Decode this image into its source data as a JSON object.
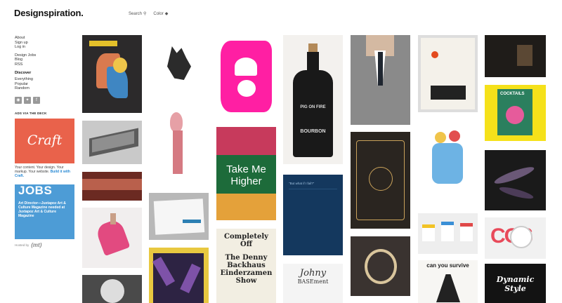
{
  "brand": {
    "logo": "Designspiration."
  },
  "topnav": {
    "search": "Search",
    "color": "Color"
  },
  "sidebar": {
    "group1": [
      "About",
      "Sign up",
      "Log in"
    ],
    "group2": [
      "Design Jobs",
      "Blog",
      "RSS"
    ],
    "discover_heading": "Discover",
    "discover": [
      "Everything",
      "Popular",
      "Random"
    ],
    "social": [
      "instagram-icon",
      "twitter-icon",
      "facebook-icon"
    ]
  },
  "ad": {
    "label": "ADS VIA THE DECK",
    "craft_title": "Craft",
    "craft_text": "Your content. Your design. Your markup. Your website.",
    "craft_link": "Build it with Craft."
  },
  "jobs": {
    "title": "JOBS",
    "text": "Art Director—Juxtapoz Art & Culture Magazine needed at Juxtapoz Art & Culture Magazine"
  },
  "hosted": {
    "label": "Hosted by",
    "logo": "(mt)"
  },
  "tiles": {
    "pig_a": "PIG ON FIRE",
    "pig_b": "BOURBON",
    "take": "Take Me",
    "higher": "Higher",
    "quote": "\"But what if I fail?\"",
    "poster1": "Completely",
    "poster2": "Off",
    "poster3": "The Denny",
    "poster4": "Backhaus",
    "poster5": "Einderzamen",
    "poster6": "Show",
    "cos": "COS",
    "cocktails": "COCKTAILS",
    "dynamic": "Dynamic Style",
    "survive": "can you survive",
    "johny": "Johny",
    "basement": "BASEment"
  },
  "colors": {
    "accent": "#e9624b",
    "jobs": "#4d9cd6",
    "magenta": "#ff1fa3",
    "navy": "#14385e",
    "yellow": "#f5e11a"
  }
}
